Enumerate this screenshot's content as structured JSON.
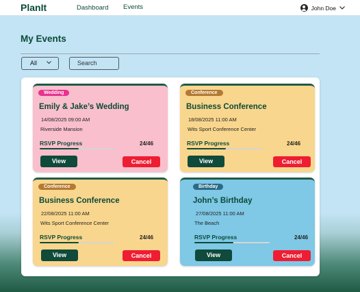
{
  "app": {
    "brand": "PlanIt",
    "nav": [
      {
        "label": "Dashboard"
      },
      {
        "label": "Events"
      }
    ],
    "user": {
      "name": "John Doe"
    }
  },
  "page": {
    "title": "My Events",
    "filter": {
      "selected": "All"
    },
    "search": {
      "placeholder": "Search"
    }
  },
  "events": [
    {
      "tag": "Wedding",
      "tag_color": "#e8338f",
      "title": "Emily & Jake’s Wedding",
      "datetime": "14/08/2025 09:00 AM",
      "venue": "Riverside Mansion",
      "rsvp_label": "RSVP Progress",
      "rsvp_count": "24/46",
      "rsvp_fraction": 0.52,
      "view_label": "View",
      "cancel_label": "Cancel",
      "card_color": "#f9bfcc"
    },
    {
      "tag": "Conference",
      "tag_color": "#b57a32",
      "title": "Business Conference",
      "datetime": "18/08/2025 11:00 AM",
      "venue": "Wits Sport Conference Center",
      "rsvp_label": "RSVP Progress",
      "rsvp_count": "24/46",
      "rsvp_fraction": 0.52,
      "view_label": "View",
      "cancel_label": "Cancel",
      "card_color": "#f9d68d"
    },
    {
      "tag": "Conference",
      "tag_color": "#b57a32",
      "title": "Business Conference",
      "datetime": "22/08/2025 11:00 AM",
      "venue": "Wits Sport Conference Center",
      "rsvp_label": "RSVP Progress",
      "rsvp_count": "24/46",
      "rsvp_fraction": 0.52,
      "view_label": "View",
      "cancel_label": "Cancel",
      "card_color": "#f9d68d"
    },
    {
      "tag": "Birthday",
      "tag_color": "#2a6b86",
      "title": "John’s Birthday",
      "datetime": "27/08/2025 11:00 AM",
      "venue": "The Beach",
      "rsvp_label": "RSVP Progress",
      "rsvp_count": "24/46",
      "rsvp_fraction": 0.52,
      "view_label": "View",
      "cancel_label": "Cancel",
      "card_color": "#7fc8e6"
    }
  ],
  "icons": {
    "user": "user-avatar-icon",
    "dropdown": "chevron-down-icon"
  }
}
